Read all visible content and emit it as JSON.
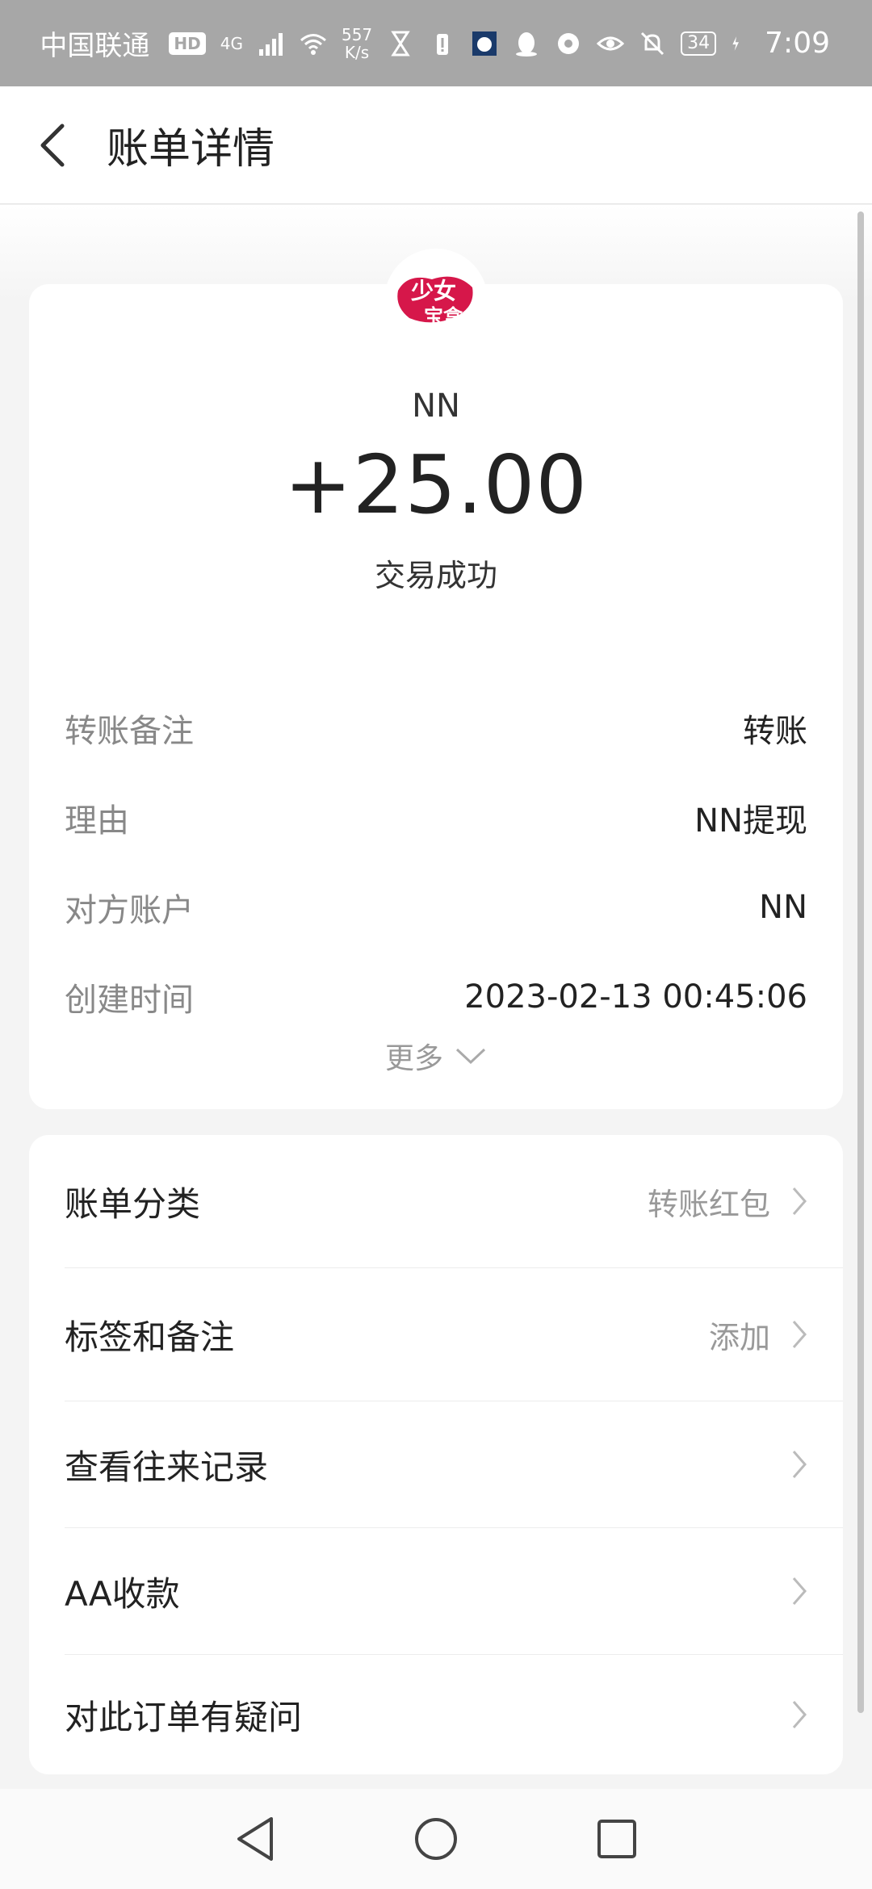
{
  "status_bar": {
    "carrier": "中国联通",
    "hd_badge": "HD",
    "network": "4G",
    "speed_value": "557",
    "speed_unit": "K/s",
    "battery": "34",
    "time": "7:09"
  },
  "header": {
    "title": "账单详情"
  },
  "transaction": {
    "logo_text_top": "少女",
    "logo_text_bottom": "宝盒",
    "counterparty": "NN",
    "amount": "+25.00",
    "status": "交易成功"
  },
  "details": [
    {
      "label": "转账备注",
      "value": "转账"
    },
    {
      "label": "理由",
      "value": "NN提现"
    },
    {
      "label": "对方账户",
      "value": "NN"
    },
    {
      "label": "创建时间",
      "value": "2023-02-13 00:45:06"
    }
  ],
  "more_label": "更多",
  "actions": [
    {
      "label": "账单分类",
      "value": "转账红包"
    },
    {
      "label": "标签和备注",
      "value": "添加"
    },
    {
      "label": "查看往来记录",
      "value": ""
    },
    {
      "label": "AA收款",
      "value": ""
    },
    {
      "label": "对此订单有疑问",
      "value": ""
    }
  ],
  "colors": {
    "status_bar_bg": "#a7a7a7",
    "logo_red": "#d6174a",
    "page_bg": "#f4f4f4"
  }
}
